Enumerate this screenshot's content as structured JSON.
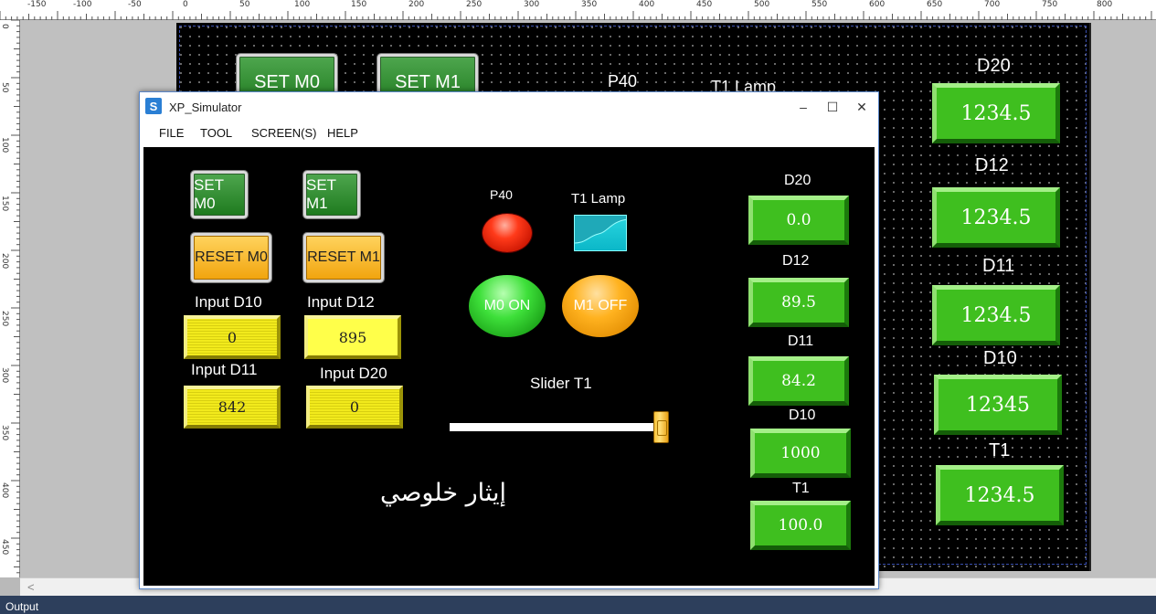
{
  "ruler": {
    "top_ticks": [
      "-150",
      "-100",
      "-50",
      "0",
      "50",
      "100",
      "150",
      "200",
      "250",
      "300",
      "350",
      "400",
      "450",
      "500",
      "550",
      "600",
      "650",
      "700",
      "750",
      "800"
    ],
    "left_ticks": [
      "0",
      "50",
      "100",
      "150",
      "200",
      "250",
      "300",
      "350",
      "400",
      "450"
    ]
  },
  "background_screen": {
    "set_m0": "SET M0",
    "set_m1": "SET M1",
    "p40": "P40",
    "t1_lamp": "T1 Lamp",
    "displays": [
      {
        "label": "D20",
        "value": "1234.5"
      },
      {
        "label": "D12",
        "value": "1234.5"
      },
      {
        "label": "D11",
        "value": "1234.5"
      },
      {
        "label": "D10",
        "value": "12345"
      },
      {
        "label": "T1",
        "value": "1234.5"
      }
    ]
  },
  "window": {
    "title": "XP_Simulator",
    "icon_letter": "S",
    "controls": {
      "minimize": "–",
      "maximize": "☐",
      "close": "✕"
    },
    "menu": [
      "FILE",
      "TOOL",
      "SCREEN(S)",
      "HELP"
    ]
  },
  "screen": {
    "set_m0": "SET M0",
    "set_m1": "SET M1",
    "reset_m0": "RESET M0",
    "reset_m1": "RESET M1",
    "inputs": [
      {
        "label": "Input D10",
        "value": "0"
      },
      {
        "label": "Input D12",
        "value": "895"
      },
      {
        "label": "Input D11",
        "value": "842"
      },
      {
        "label": "Input D20",
        "value": "0"
      }
    ],
    "p40_label": "P40",
    "t1_lamp_label": "T1 Lamp",
    "m0_lamp": "M0 ON",
    "m1_lamp": "M1 OFF",
    "slider_label": "Slider T1",
    "slider_level": 1.0,
    "arabic_text": "إيثار خلوصي",
    "displays": [
      {
        "label": "D20",
        "value": "0.0"
      },
      {
        "label": "D12",
        "value": "89.5"
      },
      {
        "label": "D11",
        "value": "84.2"
      },
      {
        "label": "D10",
        "value": "1000"
      },
      {
        "label": "T1",
        "value": "100.0"
      }
    ]
  },
  "scrollbar": {
    "left_arrow": "<"
  },
  "output_panel": {
    "title": "Output"
  },
  "colors": {
    "display_green": "#3fbf1f",
    "input_yellow": "#f2ea1c",
    "canvas": "#000000",
    "output_bar": "#2d3f5c"
  }
}
